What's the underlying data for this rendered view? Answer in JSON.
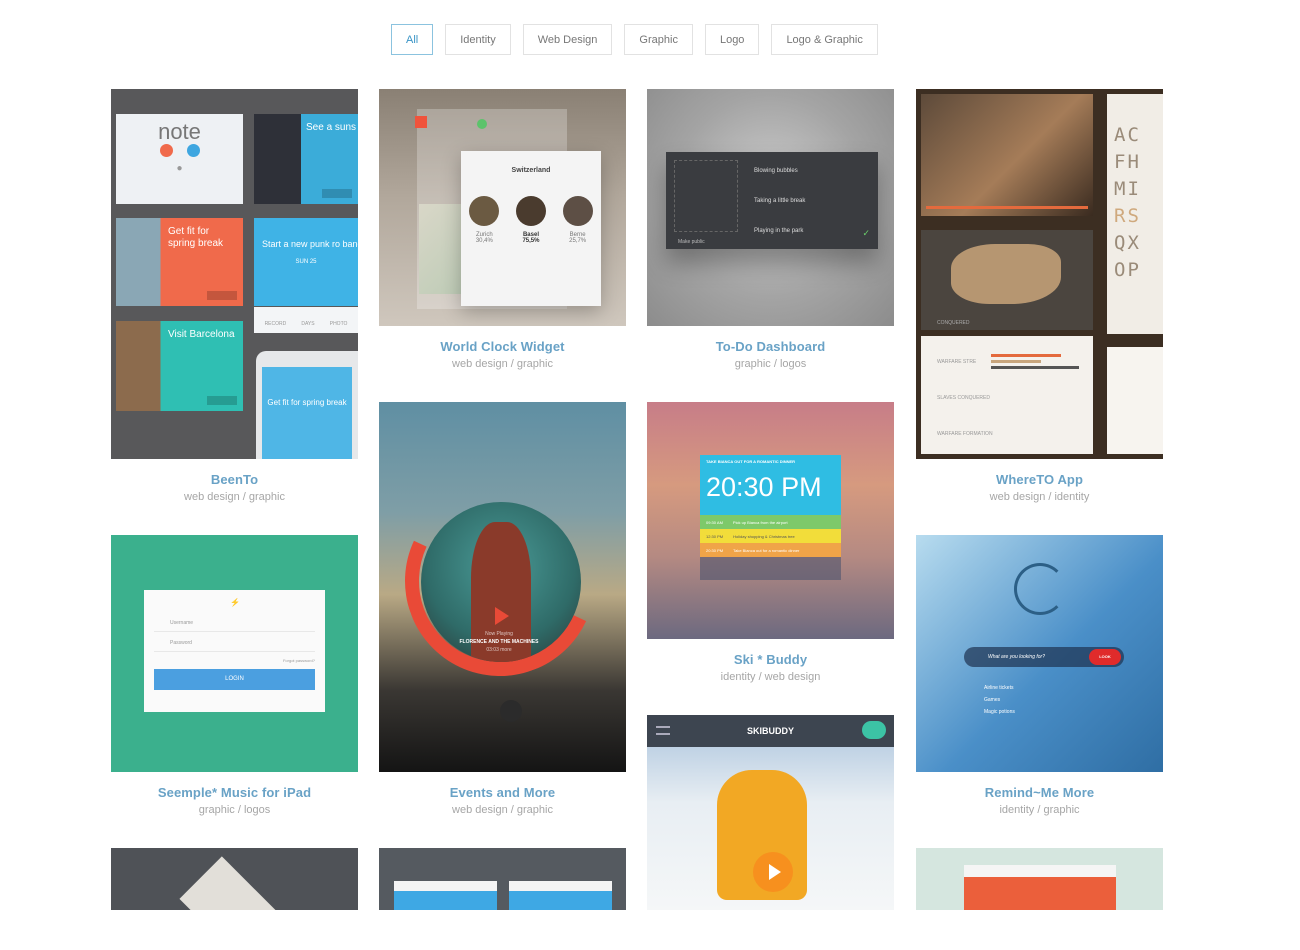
{
  "filters": [
    "All",
    "Identity",
    "Web Design",
    "Graphic",
    "Logo",
    "Logo & Graphic"
  ],
  "active_filter": "All",
  "cards": {
    "beento": {
      "title": "BeenTo",
      "categories": "web design / graphic"
    },
    "worldclock": {
      "title": "World Clock Widget",
      "categories": "web design / graphic"
    },
    "todo": {
      "title": "To-Do Dashboard",
      "categories": "graphic / logos"
    },
    "whereto": {
      "title": "WhereTO App",
      "categories": "web design / identity"
    },
    "seemple": {
      "title": "Seemple* Music for iPad",
      "categories": "graphic / logos"
    },
    "events": {
      "title": "Events and More",
      "categories": "web design / graphic"
    },
    "skibuddy": {
      "title": "Ski * Buddy",
      "categories": "identity / web design"
    },
    "remind": {
      "title": "Remind~Me More",
      "categories": "identity / graphic"
    }
  },
  "beento_art": {
    "note": "note",
    "t1": "See a suns this summe",
    "t2": "Get fit for spring break",
    "t3": "Start a new punk ro band with my mate",
    "t4": "Visit Barcelona",
    "t5": "Get fit for spring break",
    "sun": "SUN 25",
    "labels": [
      "RECORD",
      "DAYS",
      "PHOTO"
    ]
  },
  "clock_art": {
    "search": "Switzerland",
    "cities": [
      {
        "name": "Zurich",
        "temp": "30,4%"
      },
      {
        "name": "Basel",
        "temp": "75,5%"
      },
      {
        "name": "Berne",
        "temp": "25,7%"
      }
    ]
  },
  "todo_art": {
    "items": [
      "Blowing bubbles",
      "Taking a little break",
      "Playing in the park"
    ],
    "make_public": "Make public"
  },
  "whereto_art": {
    "font_sample": [
      "AC",
      "FH",
      "MI",
      "RS",
      "QX",
      "OP"
    ],
    "stats": [
      "WARFARE STRE",
      "SLAVES CONQUERED",
      "WARFARE FORMATION"
    ],
    "conquered": "CONQUERED"
  },
  "seemple_art": {
    "username": "Username",
    "password": "Password",
    "forgot": "Forgot password?",
    "login": "LOGIN"
  },
  "events_art": {
    "now": "Now Playing",
    "track": "FLORENCE AND THE MACHINES",
    "time": "03:03 more"
  },
  "ski_art": {
    "header": "TAKE BIANCA OUT FOR A ROMANTIC DINNER",
    "time": "20:30 PM",
    "rows": [
      {
        "t": "09:30 AM",
        "txt": "Pick up Bianca from the airport"
      },
      {
        "t": "12:30 PM",
        "txt": "Holiday shopping & Christmas tree"
      },
      {
        "t": "20:30 PM",
        "txt": "Take Bianca out for a romantic dinner"
      }
    ]
  },
  "remind_art": {
    "placeholder": "What are you looking for?",
    "look": "LOOK",
    "options": [
      "Airline tickets",
      "Games",
      "Magic potions"
    ]
  },
  "skiapp_art": {
    "title": "SKIBUDDY"
  }
}
